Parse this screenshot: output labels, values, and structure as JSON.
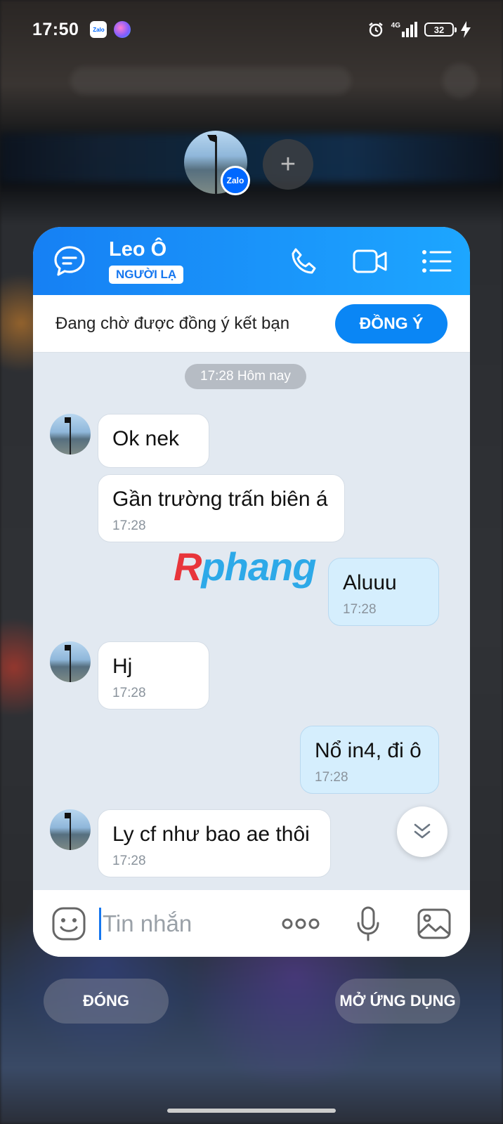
{
  "status_bar": {
    "time": "17:50",
    "network": "4G",
    "battery": "32",
    "icons": [
      "zalo-notification-icon",
      "app-notification-icon",
      "alarm-icon",
      "signal-icon",
      "battery-icon",
      "charging-icon"
    ]
  },
  "bubble": {
    "badge_label": "Zalo",
    "add_label": "+"
  },
  "chat": {
    "contact_name": "Leo Ô",
    "contact_tag": "NGƯỜI LẠ",
    "header_icons": [
      "chat-bubble-icon",
      "phone-icon",
      "video-call-icon",
      "menu-list-icon"
    ],
    "friend_request_text": "Đang chờ được đồng ý kết bạn",
    "accept_label": "ĐỒNG Ý",
    "date_separator": "17:28 Hôm nay",
    "messages": [
      {
        "sender": "them",
        "text": "Ok nek",
        "time": ""
      },
      {
        "sender": "them",
        "text": "Gần trường trấn biên á",
        "time": "17:28"
      },
      {
        "sender": "me",
        "text": "Aluuu",
        "time": "17:28"
      },
      {
        "sender": "them",
        "text": "Hj",
        "time": "17:28"
      },
      {
        "sender": "me",
        "text": "Nổ in4, đi ô",
        "time": "17:28"
      },
      {
        "sender": "them",
        "text": "Ly cf như bao ae thôi",
        "time": "17:28"
      }
    ],
    "input_placeholder": "Tin nhắn",
    "input_icons": [
      "emoji-sticker-icon",
      "more-options-icon",
      "microphone-icon",
      "image-gallery-icon"
    ]
  },
  "watermark": {
    "first": "R",
    "rest": "phang"
  },
  "actions": {
    "close_label": "ĐÓNG",
    "open_app_label": "MỞ ỨNG DỤNG"
  },
  "colors": {
    "header_start": "#1680f4",
    "header_end": "#1da6ff",
    "accept_button": "#0a86f5",
    "my_bubble": "#d5eefd",
    "chat_background": "#e2e9f1"
  }
}
